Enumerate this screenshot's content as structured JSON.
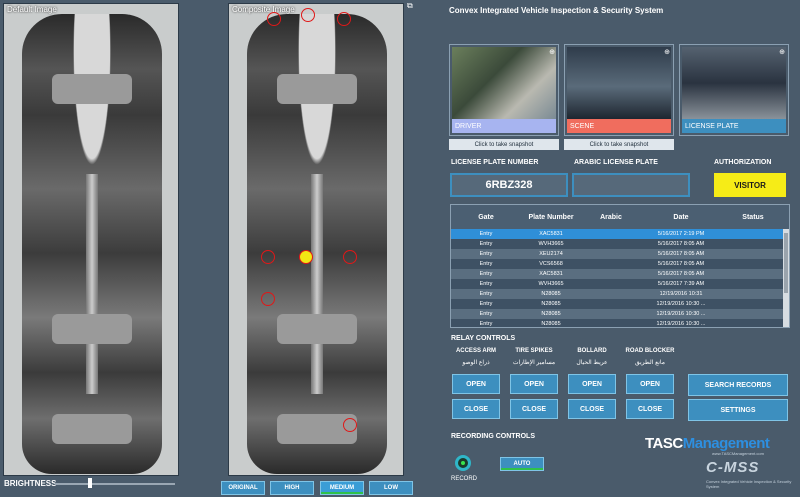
{
  "panels": {
    "default_caption": "Default Image",
    "composite_caption": "Composite Image"
  },
  "brightness": {
    "label": "BRIGHTNESS",
    "level": 0.28
  },
  "quality_buttons": [
    "ORIGINAL",
    "HIGH",
    "MEDIUM",
    "LOW"
  ],
  "app_title": "Convex Integrated Vehicle Inspection & Security System",
  "snapshots": [
    {
      "label": "DRIVER",
      "color": "#a7b4f0",
      "action": "Click to take snapshot"
    },
    {
      "label": "SCENE",
      "color": "#f06d5e",
      "action": "Click to take snapshot"
    },
    {
      "label": "LICENSE PLATE",
      "color": "#3d8fbf",
      "action": ""
    }
  ],
  "plate": {
    "number_label": "LICENSE PLATE NUMBER",
    "number_value": "6RBZ328",
    "arabic_label": "ARABIC LICENSE PLATE",
    "arabic_value": ""
  },
  "authorization": {
    "label": "AUTHORIZATION",
    "value": "VISITOR"
  },
  "table": {
    "columns": [
      "Gate",
      "Plate Number",
      "Arabic",
      "Date",
      "Status"
    ],
    "rows": [
      [
        "Entry",
        "XAC5831",
        "",
        "5/16/2017 2:19 PM",
        ""
      ],
      [
        "Entry",
        "WVH3665",
        "",
        "5/16/2017 8:05 AM",
        ""
      ],
      [
        "Entry",
        "XEU2174",
        "",
        "5/16/2017 8:05 AM",
        ""
      ],
      [
        "Entry",
        "VCS6568",
        "",
        "5/16/2017 8:05 AM",
        ""
      ],
      [
        "Entry",
        "XAC5831",
        "",
        "5/16/2017 8:05 AM",
        ""
      ],
      [
        "Entry",
        "WVH3665",
        "",
        "5/16/2017 7:39 AM",
        ""
      ],
      [
        "Entry",
        "N28085",
        "",
        "12/19/2016 10:31",
        ""
      ],
      [
        "Entry",
        "N28085",
        "",
        "12/19/2016 10:30 ...",
        ""
      ],
      [
        "Entry",
        "N28085",
        "",
        "12/19/2016 10:30 ...",
        ""
      ],
      [
        "Entry",
        "N28085",
        "",
        "12/19/2016 10:30 ...",
        ""
      ]
    ]
  },
  "relay": {
    "title": "RELAY CONTROLS",
    "groups": [
      {
        "label": "ACCESS ARM",
        "arabic": "ذراع الوصو",
        "open": "OPEN",
        "close": "CLOSE"
      },
      {
        "label": "TIRE SPIKES",
        "arabic": "مسامير الإطارات",
        "open": "OPEN",
        "close": "CLOSE"
      },
      {
        "label": "BOLLARD",
        "arabic": "عريط الحيال",
        "open": "OPEN",
        "close": "CLOSE"
      },
      {
        "label": "ROAD BLOCKER",
        "arabic": "مانع الطريق",
        "open": "OPEN",
        "close": "CLOSE"
      }
    ]
  },
  "actions": {
    "search": "SEARCH RECORDS",
    "settings": "SETTINGS"
  },
  "recording": {
    "title": "RECORDING CONTROLS",
    "record": "RECORD",
    "auto": "AUTO"
  },
  "branding": {
    "tasc": "TASC",
    "management": "Management",
    "tasc_url": "www.TASCManagement.com",
    "cmss": "C-MSS",
    "cmss_sub": "Convex Integrated Vehicle Inspection & Security System"
  }
}
